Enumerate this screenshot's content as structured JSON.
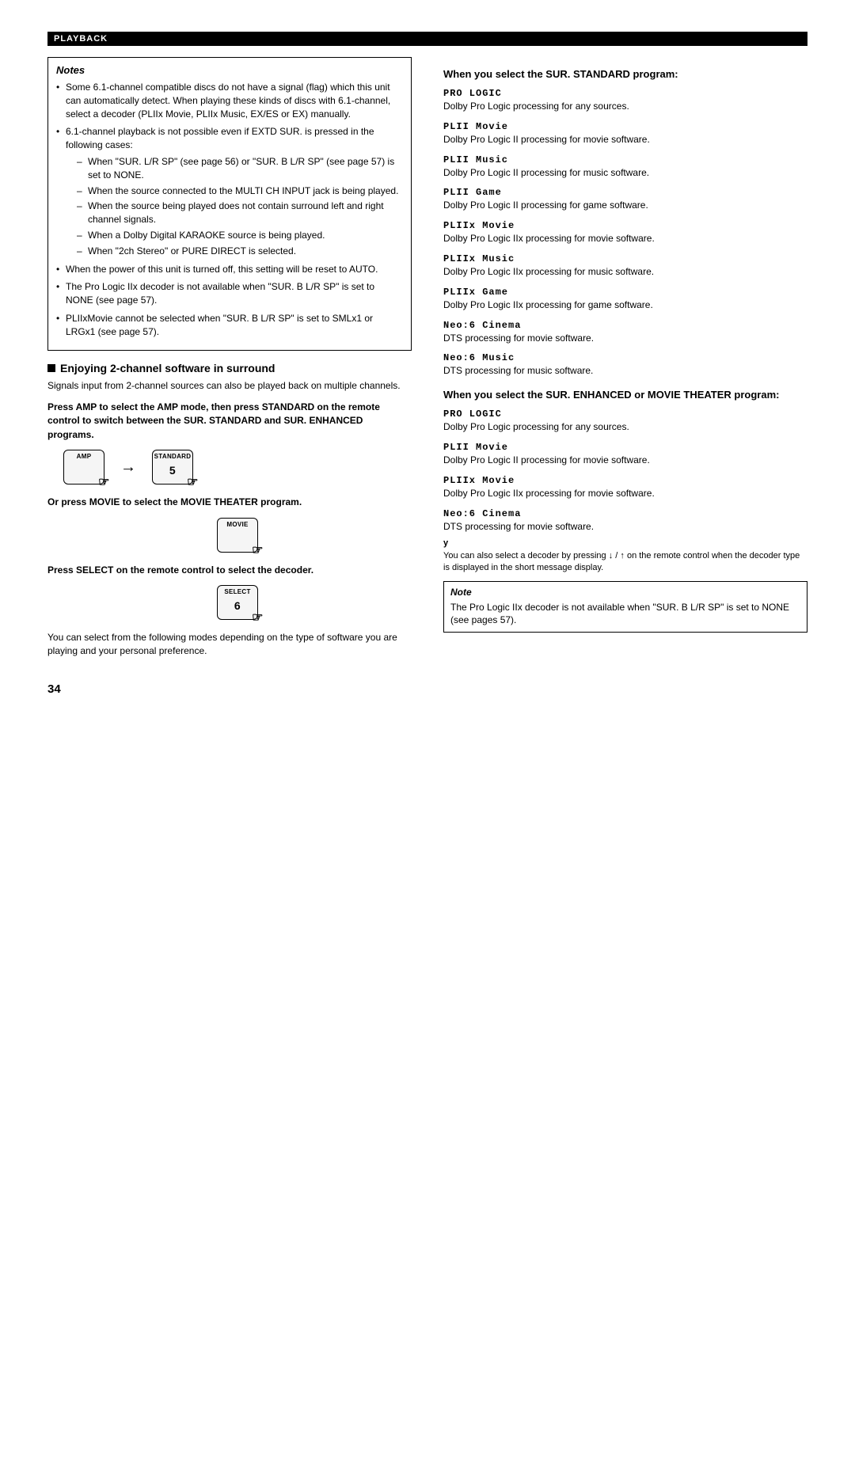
{
  "header": {
    "label": "PLAYBACK"
  },
  "page_number": "34",
  "left_col": {
    "notes_title": "Notes",
    "notes_items": [
      "Some 6.1-channel compatible discs do not have a signal (flag) which this unit can automatically detect. When playing these kinds of discs with 6.1-channel, select a decoder (PLIIx Movie, PLIIx Music, EX/ES or EX) manually.",
      "6.1-channel playback is not possible even if EXTD SUR. is pressed in the following cases:"
    ],
    "sub_items": [
      "When \"SUR. L/R SP\" (see page 56) or \"SUR. B L/R SP\" (see page 57) is set to NONE.",
      "When the source connected to the MULTI CH INPUT jack is being played.",
      "When the source being played does not contain surround left and right channel signals.",
      "When a Dolby Digital KARAOKE source is being played.",
      "When \"2ch Stereo\" or PURE DIRECT is selected."
    ],
    "notes_extra": [
      "When the power of this unit is turned off, this setting will be reset to AUTO.",
      "The Pro Logic IIx decoder is not available when \"SUR. B L/R SP\" is set to NONE (see page 57).",
      "PLIIxMovie cannot be selected when \"SUR. B L/R SP\" is set to SMLx1 or LRGx1 (see page 57)."
    ],
    "section_heading": "Enjoying 2-channel software in surround",
    "section_body": "Signals input from 2-channel sources can also be played back on multiple channels.",
    "instruction_1": "Press AMP to select the AMP mode, then press STANDARD on the remote control to switch between the SUR. STANDARD and SUR. ENHANCED programs.",
    "btn1_label": "AMP",
    "btn2_label": "STANDARD",
    "btn2_number": "5",
    "instruction_2": "Or press MOVIE to select the MOVIE THEATER program.",
    "btn3_label": "MOVIE",
    "instruction_3": "Press SELECT on the remote control to select the decoder.",
    "btn4_label": "SELECT",
    "btn4_number": "6",
    "footer_text": "You can select from the following modes depending on the type of software you are playing and your personal preference."
  },
  "right_col": {
    "section1_title": "When you select the SUR. STANDARD program:",
    "programs_standard": [
      {
        "name": "PRO LOGIC",
        "desc": "Dolby Pro Logic processing for any sources."
      },
      {
        "name": "PLII Movie",
        "desc": "Dolby Pro Logic II processing for movie software."
      },
      {
        "name": "PLII Music",
        "desc": "Dolby Pro Logic II processing for music software."
      },
      {
        "name": "PLII Game",
        "desc": "Dolby Pro Logic II processing for game software."
      },
      {
        "name": "PLIIx Movie",
        "desc": "Dolby Pro Logic IIx processing for movie software."
      },
      {
        "name": "PLIIx Music",
        "desc": "Dolby Pro Logic IIx processing for music software."
      },
      {
        "name": "PLIIx Game",
        "desc": "Dolby Pro Logic IIx processing for game software."
      },
      {
        "name": "Neo:6 Cinema",
        "desc": "DTS processing for movie software."
      },
      {
        "name": "Neo:6 Music",
        "desc": "DTS processing for music software."
      }
    ],
    "section2_title": "When you select the SUR. ENHANCED or MOVIE THEATER program:",
    "programs_enhanced": [
      {
        "name": "PRO LOGIC",
        "desc": "Dolby Pro Logic processing for any sources."
      },
      {
        "name": "PLII Movie",
        "desc": "Dolby Pro Logic II processing for movie software."
      },
      {
        "name": "PLIIx Movie",
        "desc": "Dolby Pro Logic IIx processing for movie software."
      },
      {
        "name": "Neo:6 Cinema",
        "desc": "DTS processing for movie software."
      }
    ],
    "italic_note": "You can also select a decoder by pressing ↓ / ↑ on the remote control when the decoder type is displayed in the short message display.",
    "note_small_title": "Note",
    "note_small_text": "The Pro Logic IIx decoder is not available when \"SUR. B L/R SP\" is set to NONE (see pages 57)."
  }
}
